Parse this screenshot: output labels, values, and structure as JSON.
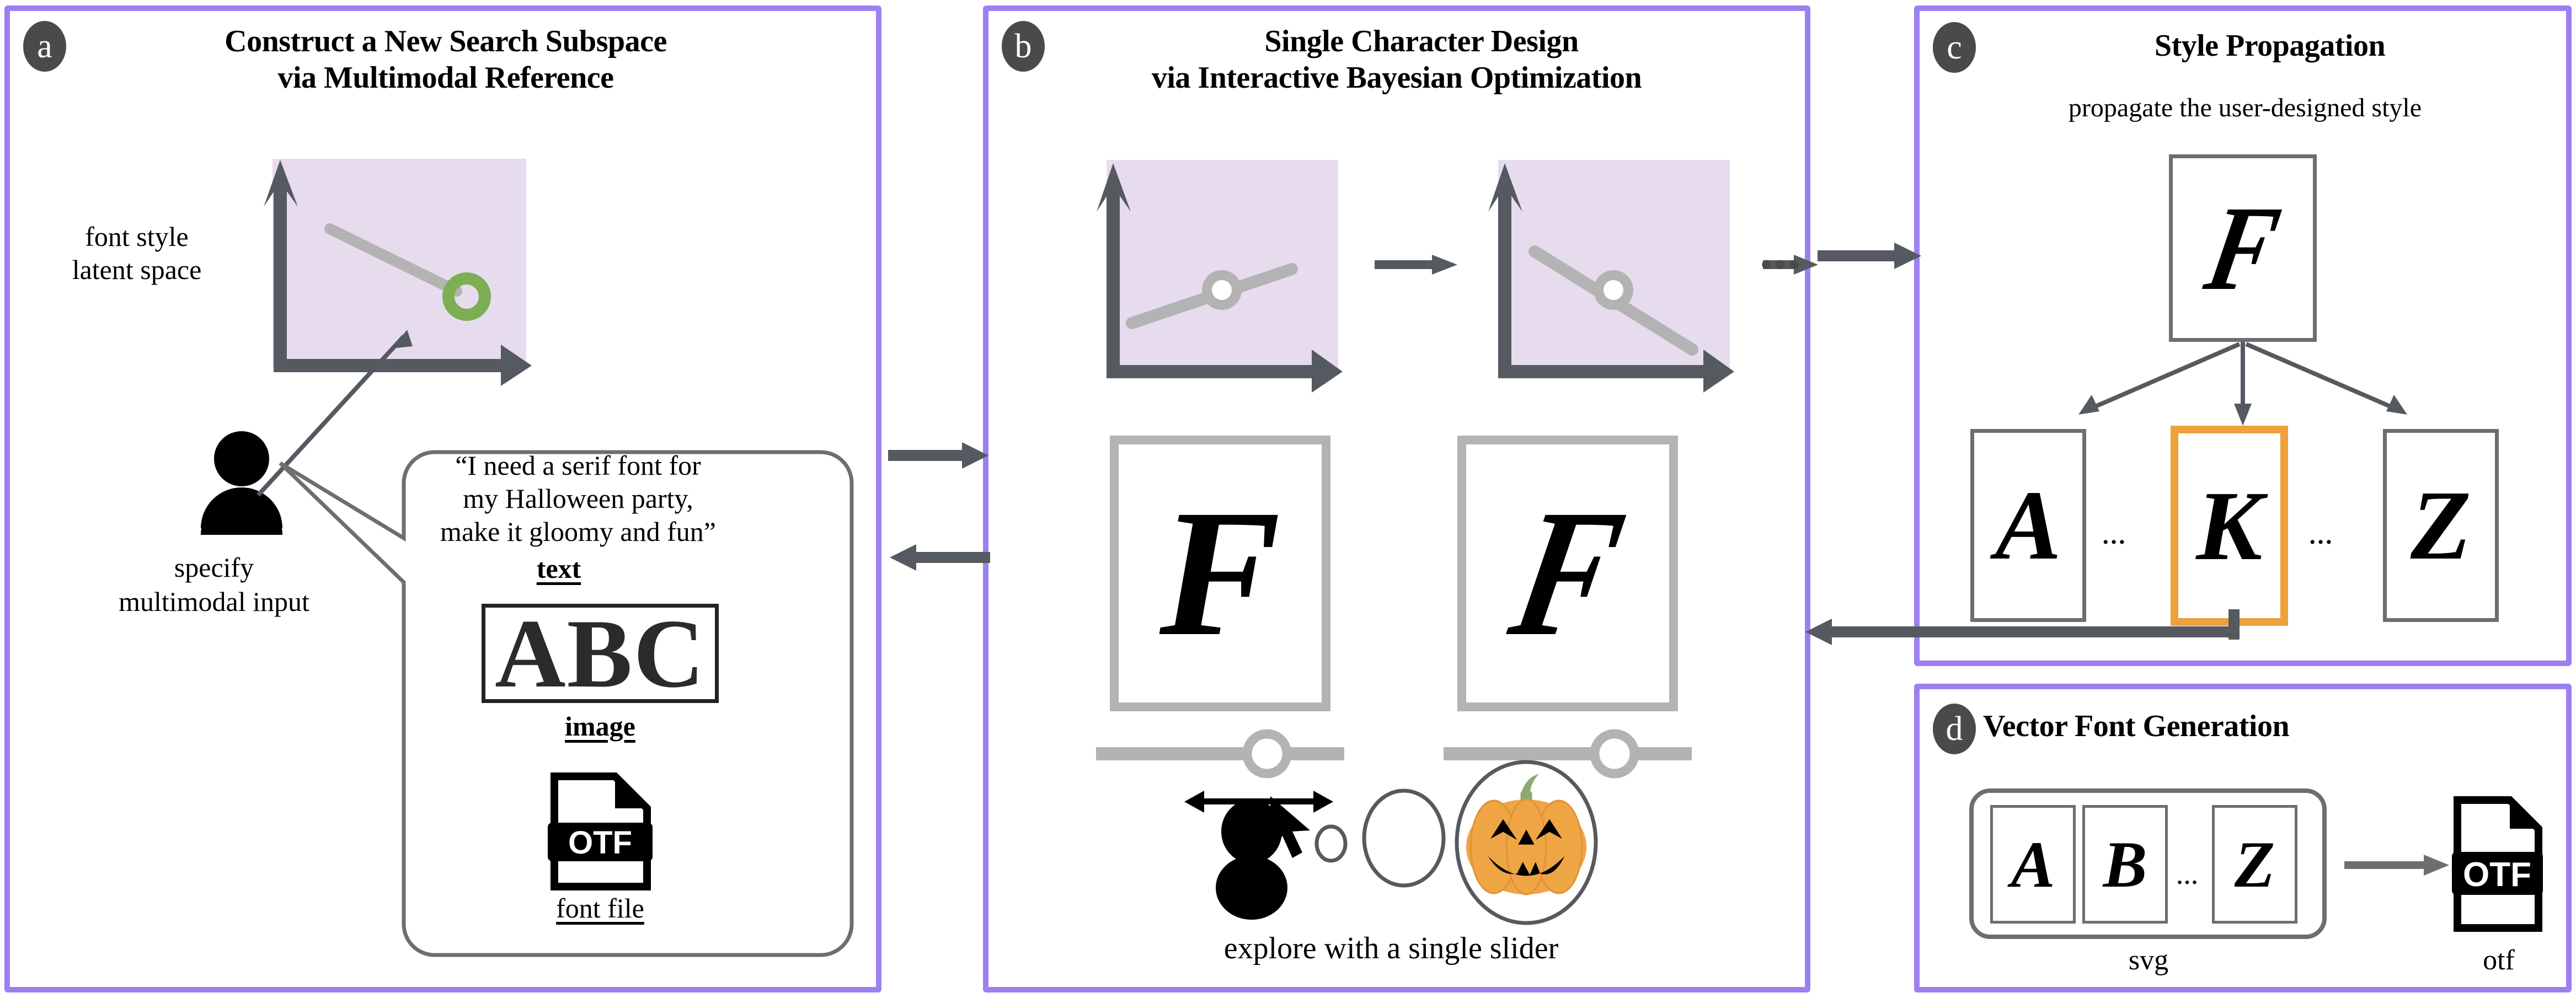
{
  "colors": {
    "panel_border": "#9d80f0",
    "badge_bg": "#4a4a4a",
    "arrow_gray": "#555a60",
    "latent_fill": "#e6dcee",
    "light_gray": "#b3b3b3",
    "green_point": "#7cae53",
    "highlight_orange": "#efa13c",
    "pumpkin_orange": "#f0a545",
    "stem_green": "#8fa871"
  },
  "panels": {
    "a": {
      "badge": "a",
      "title_line1": "Construct a New Search Subspace",
      "title_line2": "via Multimodal Reference",
      "latent_label_line1": "font style",
      "latent_label_line2": "latent space",
      "user_label_line1": "specify",
      "user_label_line2": "multimodal input",
      "bubble": {
        "quote_line1": "“I need a serif font for",
        "quote_line2": "my Halloween party,",
        "quote_line3": "make it gloomy and fun”",
        "text_caption": "text",
        "image_glyphs": "ABC",
        "image_caption": "image",
        "file_badge": "OTF",
        "file_caption": "font file"
      }
    },
    "b": {
      "badge": "b",
      "title_line1": "Single Character Design",
      "title_line2": "via Interactive Bayesian Optimization",
      "ellipsis": "•••",
      "glyph_left": "F",
      "glyph_right": "F",
      "footer": "explore with a single slider"
    },
    "c": {
      "badge": "c",
      "title": "Style Propagation",
      "subtitle": "propagate the user-designed style",
      "source_glyph": "F",
      "targets": [
        {
          "glyph": "A",
          "highlighted": false
        },
        {
          "glyph": "K",
          "highlighted": true
        },
        {
          "glyph": "Z",
          "highlighted": false
        }
      ],
      "separator": "…"
    },
    "d": {
      "badge": "d",
      "title": "Vector Font Generation",
      "glyphs": [
        "A",
        "B",
        "Z"
      ],
      "separator": "…",
      "svg_caption": "svg",
      "file_badge": "OTF",
      "otf_caption": "otf"
    }
  }
}
